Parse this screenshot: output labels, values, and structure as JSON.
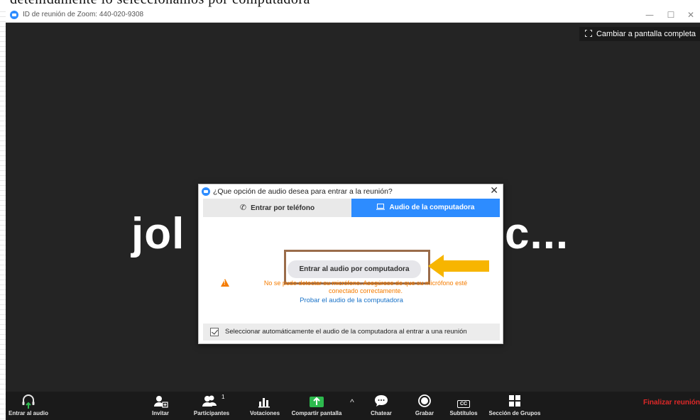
{
  "document": {
    "cropped_text": "detenidamente lo seleccionamos por computadora"
  },
  "window": {
    "title": "ID de reunión de Zoom: 440-020-9308",
    "minimize_glyph": "—",
    "maximize_glyph": "☐",
    "close_glyph": "✕"
  },
  "video": {
    "fullscreen_label": "Cambiar a pantalla completa",
    "participant_name_left": "jol",
    "participant_name_right": "c..."
  },
  "dialog": {
    "title": "¿Que opción de audio desea para entrar a la reunión?",
    "close_glyph": "✕",
    "tabs": [
      {
        "label": "Entrar por teléfono",
        "icon": "phone-icon",
        "active": false
      },
      {
        "label": "Audio de la computadora",
        "icon": "laptop-icon",
        "active": true
      }
    ],
    "join_button": "Entrar al audio por computadora",
    "warning_line1": "No se pudo detectar su micrófono. Asegúrese de que su micrófono esté",
    "warning_line2": "conectado correctamente.",
    "test_link": "Probar el audio de la computadora",
    "auto_select_label": "Seleccionar automáticamente el audio de la computadora al entrar a una reunión",
    "auto_select_checked": true
  },
  "annotation": {
    "arrow_color": "#f7b500",
    "box_color": "#9a6c4a"
  },
  "toolbar": {
    "join_audio": "Entrar al audio",
    "invite": "Invitar",
    "participants": "Participantes",
    "participants_count": "1",
    "polls": "Votaciones",
    "share_screen": "Compartir pantalla",
    "share_caret": "^",
    "chat": "Chatear",
    "record": "Grabar",
    "captions": "Subtítulos",
    "captions_icon_text": "CC",
    "breakout": "Sección de Grupos",
    "end_meeting": "Finalizar reunión"
  },
  "colors": {
    "accent": "#2d8cff",
    "warning": "#f57c00",
    "share_green": "#2dba4e",
    "end_red": "#e02828"
  }
}
